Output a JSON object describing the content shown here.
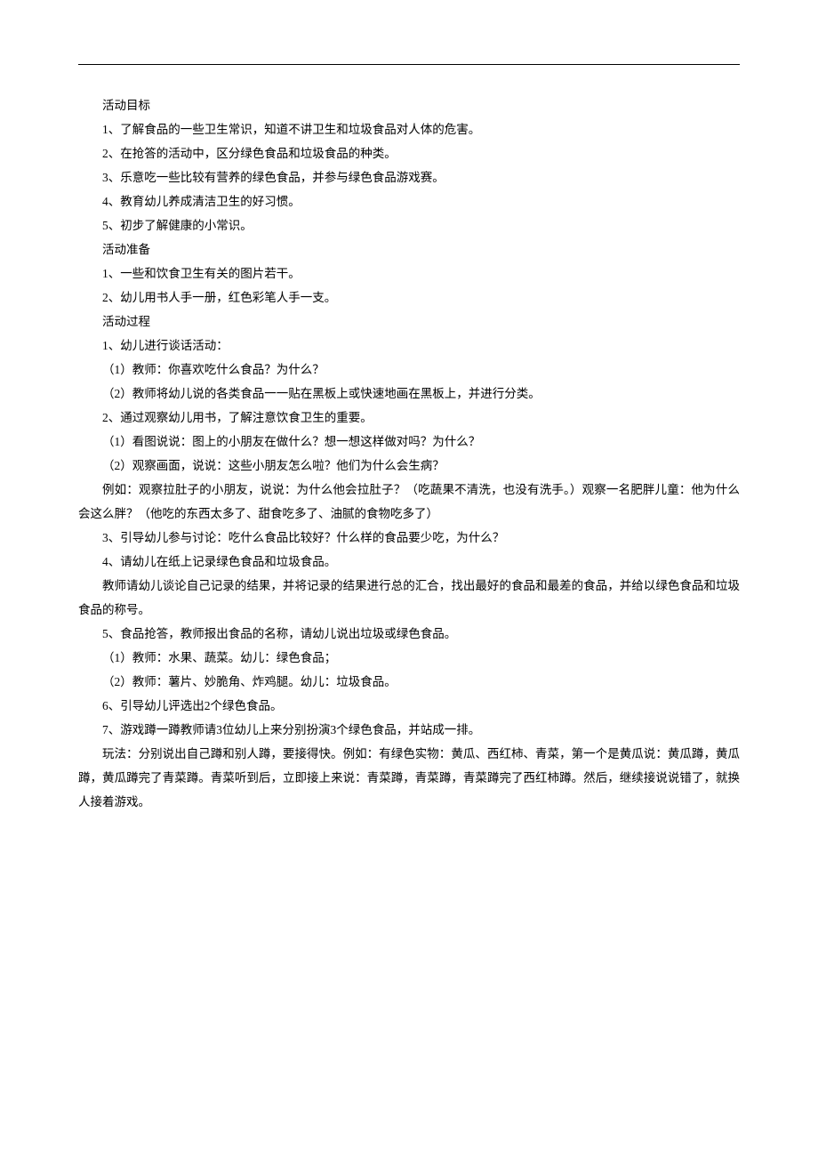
{
  "sections": {
    "goals_header": "活动目标",
    "goals": [
      "1、了解食品的一些卫生常识，知道不讲卫生和垃圾食品对人体的危害。",
      "2、在抢答的活动中，区分绿色食品和垃圾食品的种类。",
      "3、乐意吃一些比较有营养的绿色食品，并参与绿色食品游戏赛。",
      "4、教育幼儿养成清洁卫生的好习惯。",
      "5、初步了解健康的小常识。"
    ],
    "prep_header": "活动准备",
    "prep": [
      "1、一些和饮食卫生有关的图片若干。",
      "2、幼儿用书人手一册，红色彩笔人手一支。"
    ],
    "process_header": "活动过程",
    "process": [
      {
        "text": "1、幼儿进行谈话活动：",
        "indent": true
      },
      {
        "text": "（1）教师：你喜欢吃什么食品？为什么？",
        "indent": true
      },
      {
        "text": "（2）教师将幼儿说的各类食品一一贴在黑板上或快速地画在黑板上，并进行分类。",
        "indent": true
      },
      {
        "text": "2、通过观察幼儿用书，了解注意饮食卫生的重要。",
        "indent": true
      },
      {
        "text": "（1）看图说说：图上的小朋友在做什么？想一想这样做对吗？为什么？",
        "indent": true
      },
      {
        "text": "（2）观察画面，说说：这些小朋友怎么啦？他们为什么会生病？",
        "indent": true
      },
      {
        "text": "例如：观察拉肚子的小朋友，说说：为什么他会拉肚子？（吃蔬果不清洗，也没有洗手。）观察一名肥胖儿童：他为什么会这么胖？（他吃的东西太多了、甜食吃多了、油腻的食物吃多了）",
        "indent": true,
        "wrap": true
      },
      {
        "text": "3、引导幼儿参与讨论：吃什么食品比较好？什么样的食品要少吃，为什么？",
        "indent": true
      },
      {
        "text": "4、请幼儿在纸上记录绿色食品和垃圾食品。",
        "indent": true
      },
      {
        "text": "教师请幼儿谈论自己记录的结果，并将记录的结果进行总的汇合，找出最好的食品和最差的食品，并给以绿色食品和垃圾食品的称号。",
        "indent": true,
        "wrap": true
      },
      {
        "text": "5、食品抢答，教师报出食品的名称，请幼儿说出垃圾或绿色食品。",
        "indent": true
      },
      {
        "text": "（1）教师：水果、蔬菜。幼儿：绿色食品；",
        "indent": true
      },
      {
        "text": "（2）教师：薯片、妙脆角、炸鸡腿。幼儿：垃圾食品。",
        "indent": true
      },
      {
        "text": "6、引导幼儿评选出2个绿色食品。",
        "indent": true
      },
      {
        "text": "7、游戏蹲一蹲教师请3位幼儿上来分别扮演3个绿色食品，并站成一排。",
        "indent": true
      },
      {
        "text": "玩法：分别说出自己蹲和别人蹲，要接得快。例如：有绿色实物：黄瓜、西红柿、青菜，第一个是黄瓜说：黄瓜蹲，黄瓜蹲，黄瓜蹲完了青菜蹲。青菜听到后，立即接上来说：青菜蹲，青菜蹲，青菜蹲完了西红柿蹲。然后，继续接说说错了，就换人接着游戏。",
        "indent": true,
        "wrap": true
      }
    ]
  }
}
